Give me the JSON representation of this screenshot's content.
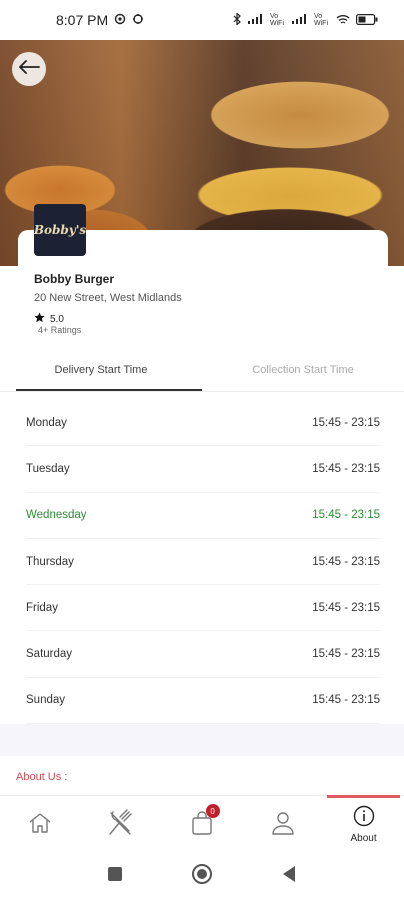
{
  "status_bar": {
    "time": "8:07 PM",
    "carrier1": "Vo WiFi",
    "carrier2": "Vo WiFi",
    "battery": "battery-icon"
  },
  "restaurant": {
    "logo_text": "Bobby's",
    "name": "Bobby Burger",
    "address": "20 New Street, West Midlands",
    "rating": "5.0",
    "ratings_count": "4+ Ratings"
  },
  "tabs": [
    {
      "label": "Delivery Start Time",
      "active": true
    },
    {
      "label": "Collection Start Time",
      "active": false
    }
  ],
  "hours": [
    {
      "day": "Monday",
      "time": "15:45 - 23:15"
    },
    {
      "day": "Tuesday",
      "time": "15:45 - 23:15"
    },
    {
      "day": "Wednesday",
      "time": "15:45 - 23:15",
      "today": true
    },
    {
      "day": "Thursday",
      "time": "15:45 - 23:15"
    },
    {
      "day": "Friday",
      "time": "15:45 - 23:15"
    },
    {
      "day": "Saturday",
      "time": "15:45 - 23:15"
    },
    {
      "day": "Sunday",
      "time": "15:45 - 23:15"
    }
  ],
  "about_heading": "About Us :",
  "bottom_nav": {
    "cart_badge": "0",
    "about_label": "About"
  },
  "colors": {
    "today": "#2e8b36",
    "accent": "#e05a66",
    "badge": "#c21f2d"
  }
}
